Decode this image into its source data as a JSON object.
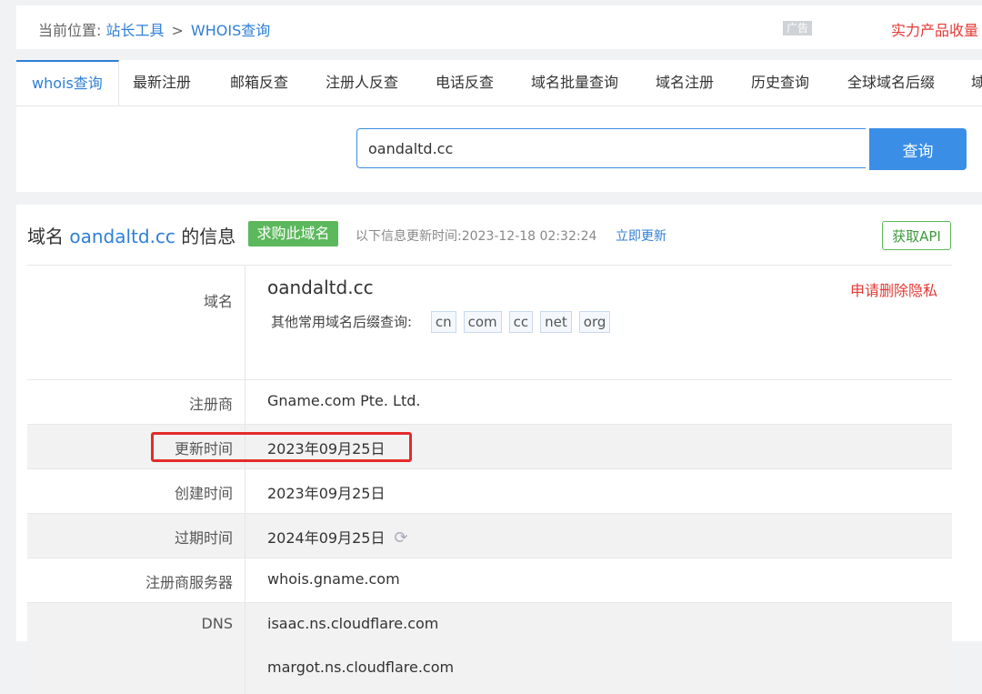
{
  "breadcrumb": {
    "prefix": "当前位置:",
    "home": "站长工具",
    "separator": ">",
    "current": "WHOIS查询"
  },
  "ad": {
    "tag": "广告",
    "text": "实力产品收量"
  },
  "tabs": [
    "whois查询",
    "最新注册",
    "邮箱反查",
    "注册人反查",
    "电话反查",
    "域名批量查询",
    "域名注册",
    "历史查询",
    "全球域名后缀",
    "域"
  ],
  "search": {
    "value": "oandaltd.cc",
    "button": "查询"
  },
  "info": {
    "title_prefix": "域名",
    "title_domain": "oandaltd.cc",
    "title_suffix": "的信息",
    "buy_button": "求购此域名",
    "update_text": "以下信息更新时间:2023-12-18 02:32:24",
    "update_link": "立即更新",
    "api_button": "获取API"
  },
  "fields": {
    "domain_label": "域名",
    "domain_value": "oandaltd.cc",
    "privacy_link": "申请删除隐私",
    "other_suffix_label": "其他常用域名后缀查询:",
    "suffixes": [
      "cn",
      "com",
      "cc",
      "net",
      "org"
    ],
    "registrar_label": "注册商",
    "registrar_value": "Gname.com Pte. Ltd.",
    "updated_label": "更新时间",
    "updated_value": "2023年09月25日",
    "created_label": "创建时间",
    "created_value": "2023年09月25日",
    "expires_label": "过期时间",
    "expires_value": "2024年09月25日",
    "whois_server_label": "注册商服务器",
    "whois_server_value": "whois.gname.com",
    "dns_label": "DNS",
    "dns": [
      "isaac.ns.cloudflare.com",
      "margot.ns.cloudflare.com"
    ]
  },
  "colors": {
    "accent": "#2f7fd6",
    "buy": "#5cb85c",
    "warning": "#e53935",
    "highlight_box": "#e32b2b"
  }
}
